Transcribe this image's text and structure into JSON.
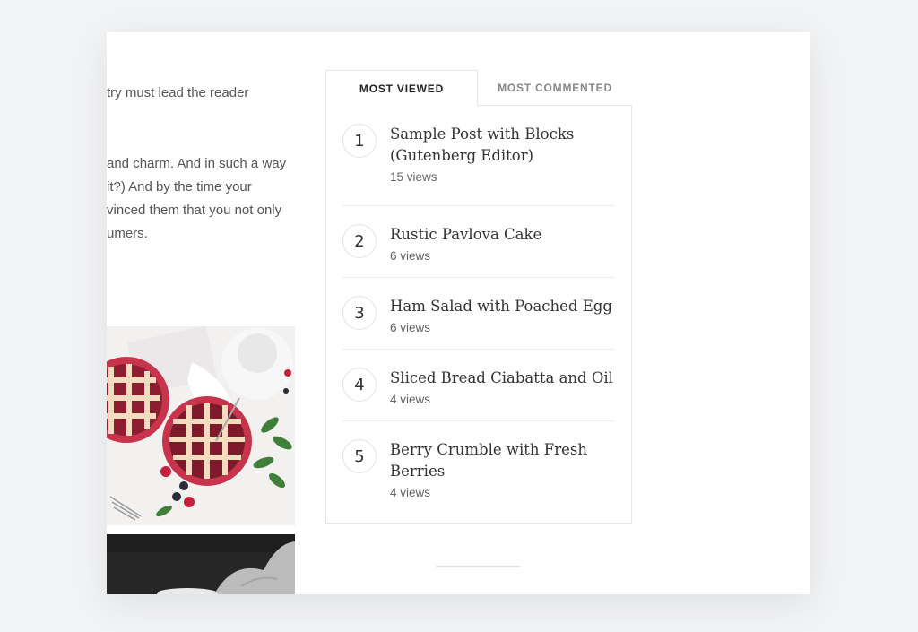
{
  "article": {
    "line1": "try must lead the reader",
    "para2": [
      " and charm. And in such a way",
      " it?) And by the time your",
      "vinced them that you not only",
      "umers."
    ]
  },
  "tabs": {
    "most_viewed": "Most Viewed",
    "most_commented": "Most Commented"
  },
  "posts": [
    {
      "rank": "1",
      "title": "Sample Post with Blocks (Gutenberg Editor)",
      "views": "15 views"
    },
    {
      "rank": "2",
      "title": "Rustic Pavlova Cake",
      "views": "6 views"
    },
    {
      "rank": "3",
      "title": "Ham Salad with Poached Egg",
      "views": "6 views"
    },
    {
      "rank": "4",
      "title": "Sliced Bread Ciabatta and Oil",
      "views": "4 views"
    },
    {
      "rank": "5",
      "title": "Berry Crumble with Fresh Berries",
      "views": "4 views"
    }
  ],
  "colors": {
    "background": "#f2f3f5",
    "card": "#ffffff",
    "border": "#e6e6e6",
    "text": "#333333"
  }
}
